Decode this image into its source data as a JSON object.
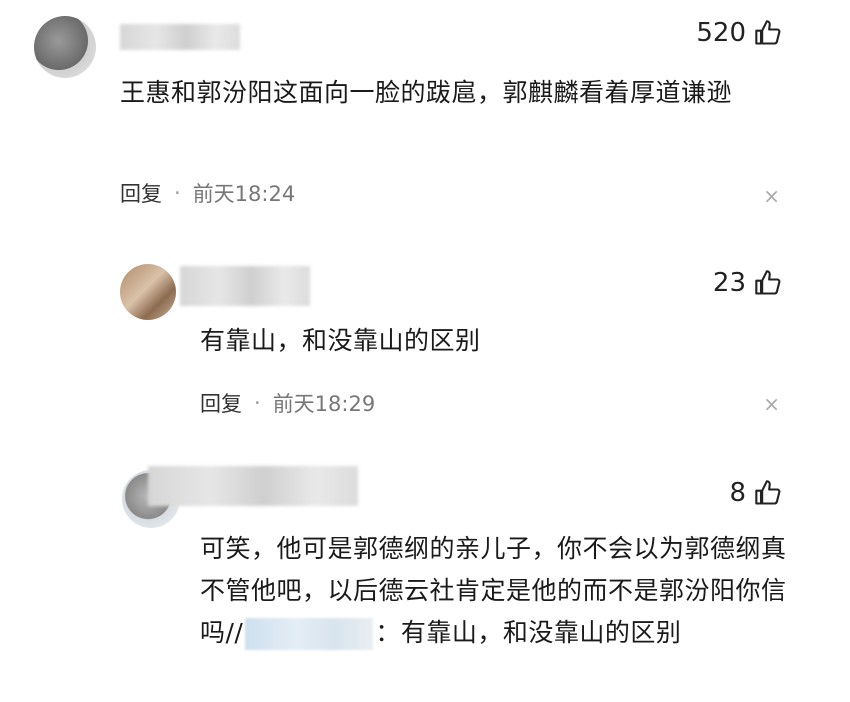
{
  "comments": [
    {
      "likes": "520",
      "text": "王惠和郭汾阳这面向一脸的跋扈，郭麒麟看着厚道谦逊",
      "reply_label": "回复",
      "separator": "·",
      "time": "前天18:24",
      "close": "×"
    },
    {
      "likes": "23",
      "text": "有靠山，和没靠山的区别",
      "reply_label": "回复",
      "separator": "·",
      "time": "前天18:29",
      "close": "×"
    },
    {
      "likes": "8",
      "text_part1": "可笑，他可是郭德纲的亲儿子，你不会以为郭德纲真不管他吧，以后德云社肯定是他的而不是郭汾阳你信吗//",
      "text_part2": "：有靠山，和没靠山的区别"
    }
  ],
  "icons": {
    "like": "thumbs-up-icon"
  }
}
